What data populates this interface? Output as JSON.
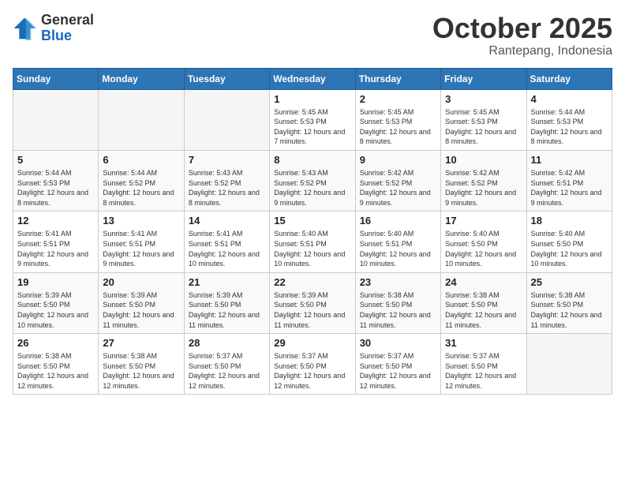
{
  "logo": {
    "general": "General",
    "blue": "Blue"
  },
  "header": {
    "month": "October 2025",
    "location": "Rantepang, Indonesia"
  },
  "days_of_week": [
    "Sunday",
    "Monday",
    "Tuesday",
    "Wednesday",
    "Thursday",
    "Friday",
    "Saturday"
  ],
  "weeks": [
    [
      {
        "day": "",
        "sunrise": "",
        "sunset": "",
        "daylight": "",
        "empty": true
      },
      {
        "day": "",
        "sunrise": "",
        "sunset": "",
        "daylight": "",
        "empty": true
      },
      {
        "day": "",
        "sunrise": "",
        "sunset": "",
        "daylight": "",
        "empty": true
      },
      {
        "day": "1",
        "sunrise": "Sunrise: 5:45 AM",
        "sunset": "Sunset: 5:53 PM",
        "daylight": "Daylight: 12 hours and 7 minutes.",
        "empty": false
      },
      {
        "day": "2",
        "sunrise": "Sunrise: 5:45 AM",
        "sunset": "Sunset: 5:53 PM",
        "daylight": "Daylight: 12 hours and 8 minutes.",
        "empty": false
      },
      {
        "day": "3",
        "sunrise": "Sunrise: 5:45 AM",
        "sunset": "Sunset: 5:53 PM",
        "daylight": "Daylight: 12 hours and 8 minutes.",
        "empty": false
      },
      {
        "day": "4",
        "sunrise": "Sunrise: 5:44 AM",
        "sunset": "Sunset: 5:53 PM",
        "daylight": "Daylight: 12 hours and 8 minutes.",
        "empty": false
      }
    ],
    [
      {
        "day": "5",
        "sunrise": "Sunrise: 5:44 AM",
        "sunset": "Sunset: 5:53 PM",
        "daylight": "Daylight: 12 hours and 8 minutes.",
        "empty": false
      },
      {
        "day": "6",
        "sunrise": "Sunrise: 5:44 AM",
        "sunset": "Sunset: 5:52 PM",
        "daylight": "Daylight: 12 hours and 8 minutes.",
        "empty": false
      },
      {
        "day": "7",
        "sunrise": "Sunrise: 5:43 AM",
        "sunset": "Sunset: 5:52 PM",
        "daylight": "Daylight: 12 hours and 8 minutes.",
        "empty": false
      },
      {
        "day": "8",
        "sunrise": "Sunrise: 5:43 AM",
        "sunset": "Sunset: 5:52 PM",
        "daylight": "Daylight: 12 hours and 9 minutes.",
        "empty": false
      },
      {
        "day": "9",
        "sunrise": "Sunrise: 5:42 AM",
        "sunset": "Sunset: 5:52 PM",
        "daylight": "Daylight: 12 hours and 9 minutes.",
        "empty": false
      },
      {
        "day": "10",
        "sunrise": "Sunrise: 5:42 AM",
        "sunset": "Sunset: 5:52 PM",
        "daylight": "Daylight: 12 hours and 9 minutes.",
        "empty": false
      },
      {
        "day": "11",
        "sunrise": "Sunrise: 5:42 AM",
        "sunset": "Sunset: 5:51 PM",
        "daylight": "Daylight: 12 hours and 9 minutes.",
        "empty": false
      }
    ],
    [
      {
        "day": "12",
        "sunrise": "Sunrise: 5:41 AM",
        "sunset": "Sunset: 5:51 PM",
        "daylight": "Daylight: 12 hours and 9 minutes.",
        "empty": false
      },
      {
        "day": "13",
        "sunrise": "Sunrise: 5:41 AM",
        "sunset": "Sunset: 5:51 PM",
        "daylight": "Daylight: 12 hours and 9 minutes.",
        "empty": false
      },
      {
        "day": "14",
        "sunrise": "Sunrise: 5:41 AM",
        "sunset": "Sunset: 5:51 PM",
        "daylight": "Daylight: 12 hours and 10 minutes.",
        "empty": false
      },
      {
        "day": "15",
        "sunrise": "Sunrise: 5:40 AM",
        "sunset": "Sunset: 5:51 PM",
        "daylight": "Daylight: 12 hours and 10 minutes.",
        "empty": false
      },
      {
        "day": "16",
        "sunrise": "Sunrise: 5:40 AM",
        "sunset": "Sunset: 5:51 PM",
        "daylight": "Daylight: 12 hours and 10 minutes.",
        "empty": false
      },
      {
        "day": "17",
        "sunrise": "Sunrise: 5:40 AM",
        "sunset": "Sunset: 5:50 PM",
        "daylight": "Daylight: 12 hours and 10 minutes.",
        "empty": false
      },
      {
        "day": "18",
        "sunrise": "Sunrise: 5:40 AM",
        "sunset": "Sunset: 5:50 PM",
        "daylight": "Daylight: 12 hours and 10 minutes.",
        "empty": false
      }
    ],
    [
      {
        "day": "19",
        "sunrise": "Sunrise: 5:39 AM",
        "sunset": "Sunset: 5:50 PM",
        "daylight": "Daylight: 12 hours and 10 minutes.",
        "empty": false
      },
      {
        "day": "20",
        "sunrise": "Sunrise: 5:39 AM",
        "sunset": "Sunset: 5:50 PM",
        "daylight": "Daylight: 12 hours and 11 minutes.",
        "empty": false
      },
      {
        "day": "21",
        "sunrise": "Sunrise: 5:39 AM",
        "sunset": "Sunset: 5:50 PM",
        "daylight": "Daylight: 12 hours and 11 minutes.",
        "empty": false
      },
      {
        "day": "22",
        "sunrise": "Sunrise: 5:39 AM",
        "sunset": "Sunset: 5:50 PM",
        "daylight": "Daylight: 12 hours and 11 minutes.",
        "empty": false
      },
      {
        "day": "23",
        "sunrise": "Sunrise: 5:38 AM",
        "sunset": "Sunset: 5:50 PM",
        "daylight": "Daylight: 12 hours and 11 minutes.",
        "empty": false
      },
      {
        "day": "24",
        "sunrise": "Sunrise: 5:38 AM",
        "sunset": "Sunset: 5:50 PM",
        "daylight": "Daylight: 12 hours and 11 minutes.",
        "empty": false
      },
      {
        "day": "25",
        "sunrise": "Sunrise: 5:38 AM",
        "sunset": "Sunset: 5:50 PM",
        "daylight": "Daylight: 12 hours and 11 minutes.",
        "empty": false
      }
    ],
    [
      {
        "day": "26",
        "sunrise": "Sunrise: 5:38 AM",
        "sunset": "Sunset: 5:50 PM",
        "daylight": "Daylight: 12 hours and 12 minutes.",
        "empty": false
      },
      {
        "day": "27",
        "sunrise": "Sunrise: 5:38 AM",
        "sunset": "Sunset: 5:50 PM",
        "daylight": "Daylight: 12 hours and 12 minutes.",
        "empty": false
      },
      {
        "day": "28",
        "sunrise": "Sunrise: 5:37 AM",
        "sunset": "Sunset: 5:50 PM",
        "daylight": "Daylight: 12 hours and 12 minutes.",
        "empty": false
      },
      {
        "day": "29",
        "sunrise": "Sunrise: 5:37 AM",
        "sunset": "Sunset: 5:50 PM",
        "daylight": "Daylight: 12 hours and 12 minutes.",
        "empty": false
      },
      {
        "day": "30",
        "sunrise": "Sunrise: 5:37 AM",
        "sunset": "Sunset: 5:50 PM",
        "daylight": "Daylight: 12 hours and 12 minutes.",
        "empty": false
      },
      {
        "day": "31",
        "sunrise": "Sunrise: 5:37 AM",
        "sunset": "Sunset: 5:50 PM",
        "daylight": "Daylight: 12 hours and 12 minutes.",
        "empty": false
      },
      {
        "day": "",
        "sunrise": "",
        "sunset": "",
        "daylight": "",
        "empty": true
      }
    ]
  ]
}
